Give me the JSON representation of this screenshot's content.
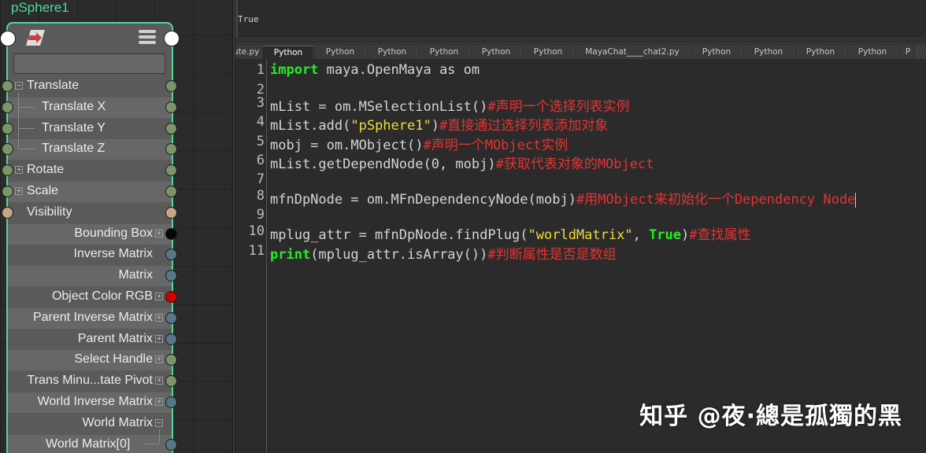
{
  "node_editor": {
    "node_name": "pSphere1",
    "attributes": [
      {
        "label": "Translate",
        "expander": "−",
        "left_plug": "green",
        "right_plug": "green"
      },
      {
        "label": "Translate X",
        "left_plug": "green",
        "right_plug": "green"
      },
      {
        "label": "Translate Y",
        "left_plug": "green",
        "right_plug": "green"
      },
      {
        "label": "Translate Z",
        "left_plug": "green",
        "right_plug": "green"
      },
      {
        "label": "Rotate",
        "expander": "+",
        "left_plug": "green",
        "right_plug": "green"
      },
      {
        "label": "Scale",
        "expander": "+",
        "left_plug": "green",
        "right_plug": "green"
      },
      {
        "label": "Visibility",
        "left_plug": "tan",
        "right_plug": "tan"
      },
      {
        "label": "Bounding Box",
        "expander": "+",
        "right_plug": "black"
      },
      {
        "label": "Inverse Matrix",
        "right_plug": "blue"
      },
      {
        "label": "Matrix",
        "right_plug": "blue"
      },
      {
        "label": "Object Color RGB",
        "expander": "+",
        "right_plug": "red"
      },
      {
        "label": "Parent Inverse Matrix",
        "expander": "+",
        "right_plug": "blue"
      },
      {
        "label": "Parent Matrix",
        "expander": "+",
        "right_plug": "blue"
      },
      {
        "label": "Select Handle",
        "expander": "+",
        "right_plug": "green"
      },
      {
        "label": "Trans Minu...tate Pivot",
        "expander": "+",
        "right_plug": "green"
      },
      {
        "label": "World Inverse Matrix",
        "expander": "+",
        "right_plug": "blue"
      },
      {
        "label": "World Matrix",
        "expander": "−"
      },
      {
        "label": "World Matrix[0]",
        "right_plug": "blue"
      }
    ]
  },
  "script_editor": {
    "output_text": "True",
    "tabs": [
      {
        "label": "Cute.py",
        "active": false
      },
      {
        "label": "Python",
        "active": true
      },
      {
        "label": "Python",
        "active": false
      },
      {
        "label": "Python",
        "active": false
      },
      {
        "label": "Python",
        "active": false
      },
      {
        "label": "Python",
        "active": false
      },
      {
        "label": "Python",
        "active": false
      },
      {
        "label": "MayaChat____chat2.py",
        "active": false
      },
      {
        "label": "Python",
        "active": false
      },
      {
        "label": "Python",
        "active": false
      },
      {
        "label": "Python",
        "active": false
      },
      {
        "label": "Python",
        "active": false
      },
      {
        "label": "P",
        "active": false
      }
    ],
    "line_numbers": [
      "1",
      "2",
      "3",
      "4",
      "5",
      "6",
      "7",
      "8",
      "9",
      "10",
      "11"
    ],
    "code": {
      "l1_kw": "import",
      "l1_rest": " maya.OpenMaya as om",
      "l3_code": "mList = om.MSelectionList()",
      "l3_comment": "#声明一个选择列表实例",
      "l4_code_a": "mList.add(",
      "l4_str": "\"pSphere1\"",
      "l4_code_b": ")",
      "l4_comment": "#直接通过选择列表添加对象",
      "l5_code": "mobj = om.MObject()",
      "l5_comment": "#声明一个MObject实例",
      "l6_code": "mList.getDependNode(0, mobj)",
      "l6_comment": "#获取代表对象的MObject",
      "l8_code": "mfnDpNode = om.MFnDependencyNode(mobj)",
      "l8_comment": "#用MObject来初始化一个Dependency Node",
      "l10_code_a": "mplug_attr = mfnDpNode.findPlug(",
      "l10_str": "\"worldMatrix\"",
      "l10_code_b": ", ",
      "l10_kw": "True",
      "l10_code_c": ")",
      "l10_comment": "#查找属性",
      "l11_kw": "print",
      "l11_code": "(mplug_attr.isArray())",
      "l11_comment": "#判断属性是否是数组"
    }
  },
  "watermark": "知乎 @夜·總是孤獨的黑"
}
